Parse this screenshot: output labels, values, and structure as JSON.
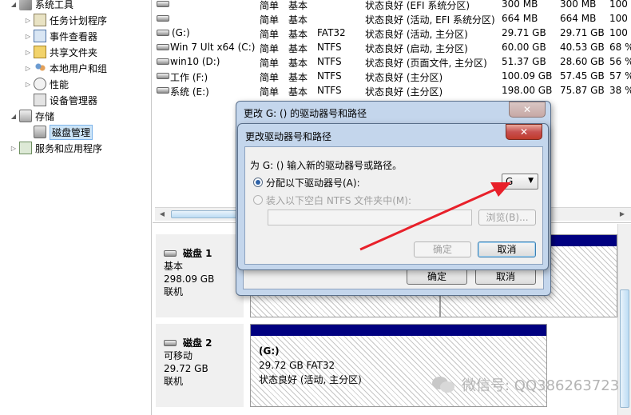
{
  "tree": {
    "items": [
      {
        "label": "系统工具",
        "icon": "tools-icon",
        "expander": "◢"
      },
      {
        "label": "任务计划程序",
        "icon": "task-scheduler-icon",
        "expander": "▷"
      },
      {
        "label": "事件查看器",
        "icon": "event-viewer-icon",
        "expander": "▷"
      },
      {
        "label": "共享文件夹",
        "icon": "shared-folder-icon",
        "expander": "▷"
      },
      {
        "label": "本地用户和组",
        "icon": "local-users-icon",
        "expander": "▷"
      },
      {
        "label": "性能",
        "icon": "performance-icon",
        "expander": "▷"
      },
      {
        "label": "设备管理器",
        "icon": "device-manager-icon",
        "expander": ""
      },
      {
        "label": "存储",
        "icon": "storage-icon",
        "expander": "◢"
      },
      {
        "label": "磁盘管理",
        "icon": "disk-management-icon",
        "expander": ""
      },
      {
        "label": "服务和应用程序",
        "icon": "services-icon",
        "expander": "▷"
      }
    ]
  },
  "volumes": {
    "rows": [
      {
        "name": "",
        "layout": "简单",
        "type": "基本",
        "fs": "",
        "status": "状态良好 (EFI 系统分区)",
        "capacity": "300 MB",
        "free": "300 MB",
        "pct": "100"
      },
      {
        "name": "",
        "layout": "简单",
        "type": "基本",
        "fs": "",
        "status": "状态良好 (活动, EFI 系统分区)",
        "capacity": "664 MB",
        "free": "664 MB",
        "pct": "100"
      },
      {
        "name": "(G:)",
        "layout": "简单",
        "type": "基本",
        "fs": "FAT32",
        "status": "状态良好 (活动, 主分区)",
        "capacity": "29.71 GB",
        "free": "29.71 GB",
        "pct": "100"
      },
      {
        "name": "Win 7 Ult x64 (C:)",
        "layout": "简单",
        "type": "基本",
        "fs": "NTFS",
        "status": "状态良好 (启动, 主分区)",
        "capacity": "60.00 GB",
        "free": "40.53 GB",
        "pct": "68 %"
      },
      {
        "name": "win10 (D:)",
        "layout": "简单",
        "type": "基本",
        "fs": "NTFS",
        "status": "状态良好 (页面文件, 主分区)",
        "capacity": "51.37 GB",
        "free": "28.60 GB",
        "pct": "56 %"
      },
      {
        "name": "工作 (F:)",
        "layout": "简单",
        "type": "基本",
        "fs": "NTFS",
        "status": "状态良好 (主分区)",
        "capacity": "100.09 GB",
        "free": "57.45 GB",
        "pct": "57 %"
      },
      {
        "name": "系统 (E:)",
        "layout": "简单",
        "type": "基本",
        "fs": "NTFS",
        "status": "状态良好 (主分区)",
        "capacity": "198.00 GB",
        "free": "75.87 GB",
        "pct": "38 %"
      }
    ]
  },
  "disks": {
    "disk1": {
      "name": "磁盘 1",
      "type": "基本",
      "size": "298.09 GB",
      "state": "联机"
    },
    "disk2": {
      "name": "磁盘 2",
      "type": "可移动",
      "size": "29.72 GB",
      "state": "联机",
      "partition": {
        "name": "(G:)",
        "size_fs": "29.72 GB FAT32",
        "status": "状态良好 (活动, 主分区)"
      }
    }
  },
  "back_dialog": {
    "title": "更改 G: () 的驱动器号和路径",
    "ok_label": "确定",
    "cancel_label": "取消",
    "close_glyph": "✕"
  },
  "front_dialog": {
    "title": "更改驱动器号和路径",
    "close_glyph": "✕",
    "prompt": "为 G: () 输入新的驱动器号或路径。",
    "option_letter": "分配以下驱动器号(A):",
    "option_folder": "装入以下空白 NTFS 文件夹中(M):",
    "letter_value": "G",
    "browse_label": "浏览(B)...",
    "ok_label": "确定",
    "cancel_label": "取消"
  },
  "watermark": {
    "text": "微信号: QQ386263723"
  },
  "colors": {
    "partition_bar": "#000080",
    "annotation_arrow": "#e8202a"
  }
}
